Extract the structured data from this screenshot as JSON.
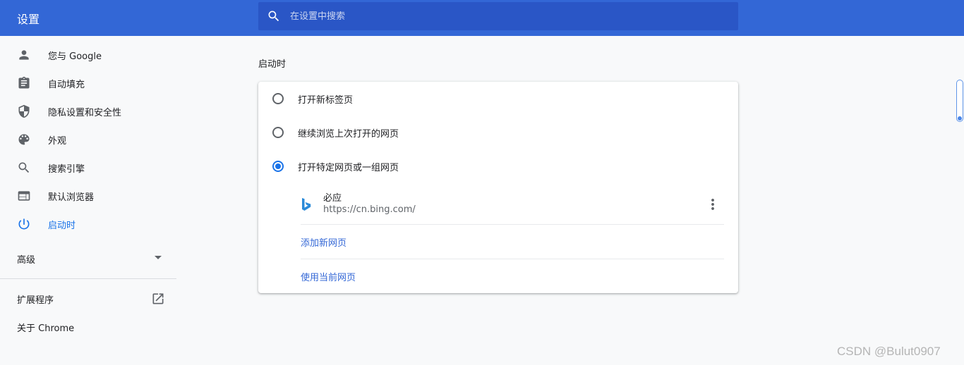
{
  "header": {
    "title": "设置",
    "search_placeholder": "在设置中搜索"
  },
  "sidebar": {
    "items": [
      {
        "label": "您与 Google",
        "icon": "person-icon"
      },
      {
        "label": "自动填充",
        "icon": "clipboard-icon"
      },
      {
        "label": "隐私设置和安全性",
        "icon": "shield-icon"
      },
      {
        "label": "外观",
        "icon": "palette-icon"
      },
      {
        "label": "搜索引擎",
        "icon": "search-icon"
      },
      {
        "label": "默认浏览器",
        "icon": "browser-window-icon"
      },
      {
        "label": "启动时",
        "icon": "power-icon",
        "active": true
      }
    ],
    "advanced_label": "高级",
    "extensions_label": "扩展程序",
    "about_label": "关于 Chrome"
  },
  "main": {
    "section_title": "启动时",
    "options": [
      {
        "label": "打开新标签页",
        "checked": false
      },
      {
        "label": "继续浏览上次打开的网页",
        "checked": false
      },
      {
        "label": "打开特定网页或一组网页",
        "checked": true
      }
    ],
    "site": {
      "name": "必应",
      "url": "https://cn.bing.com/",
      "icon": "bing-icon"
    },
    "add_page_label": "添加新网页",
    "use_current_label": "使用当前网页"
  },
  "colors": {
    "header_bg": "#3367d6",
    "accent": "#1a73e8",
    "link": "#3367d6"
  },
  "watermark": "CSDN @Bulut0907"
}
